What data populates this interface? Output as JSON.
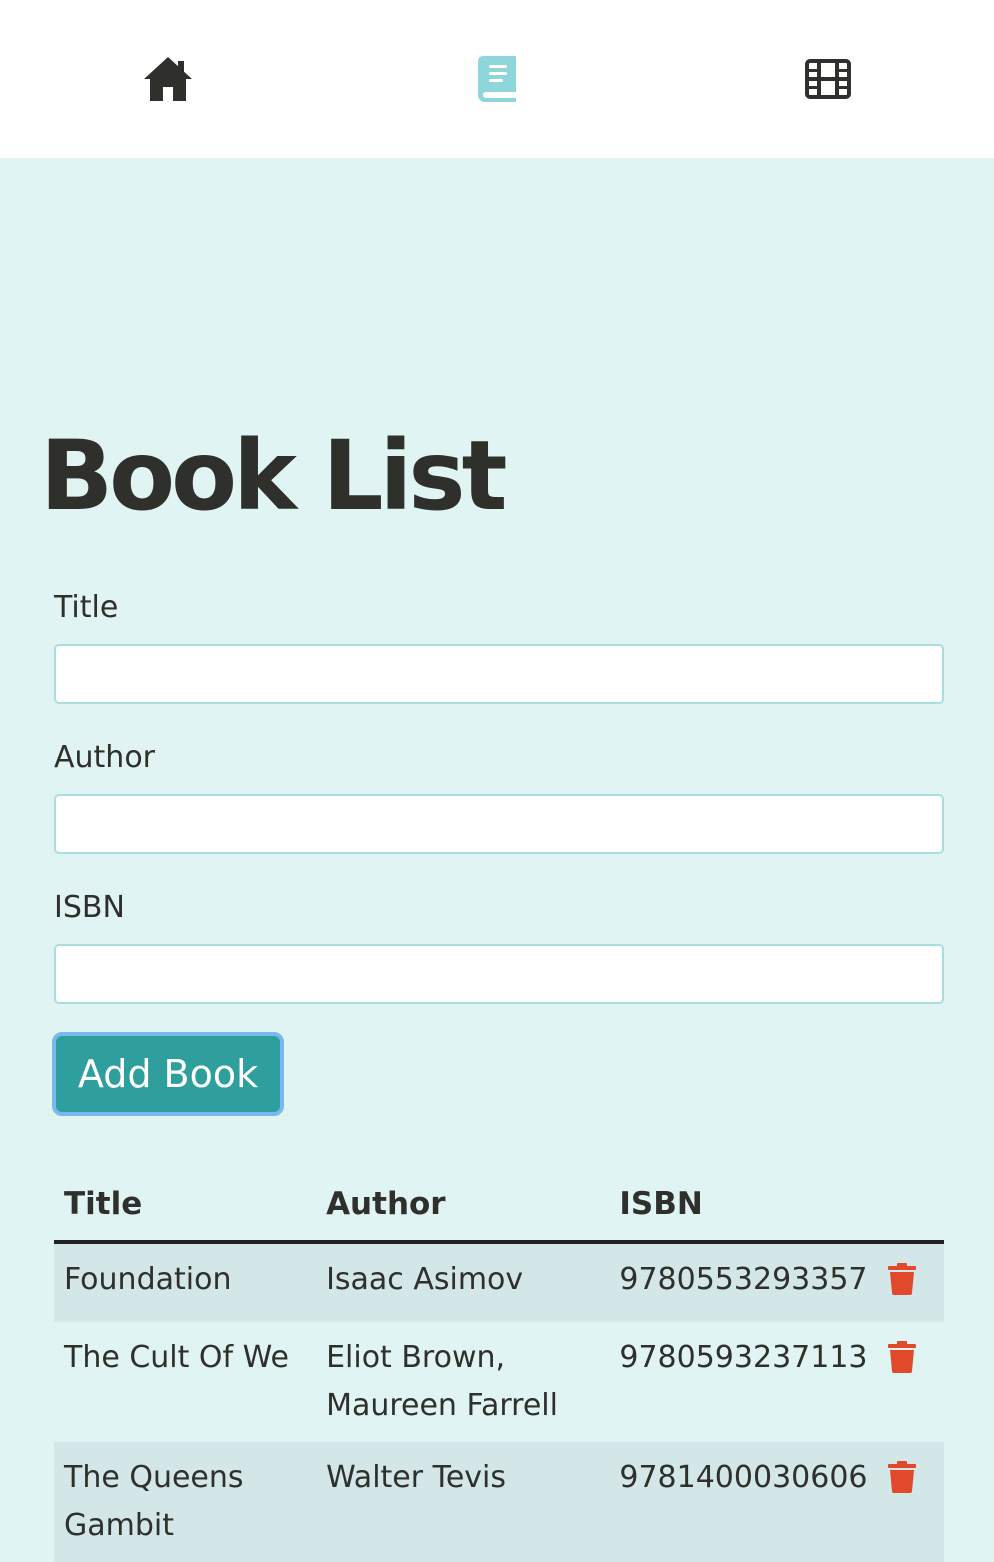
{
  "nav": {
    "items": [
      {
        "name": "home",
        "icon": "home-icon",
        "active": false
      },
      {
        "name": "books",
        "icon": "book-icon",
        "active": true
      },
      {
        "name": "movies",
        "icon": "film-icon",
        "active": false
      }
    ],
    "active_color": "#8fd6da",
    "inactive_color": "#2f302c"
  },
  "page": {
    "title": "Book List"
  },
  "form": {
    "title_label": "Title",
    "title_value": "",
    "author_label": "Author",
    "author_value": "",
    "isbn_label": "ISBN",
    "isbn_value": "",
    "submit_label": "Add Book"
  },
  "table": {
    "headers": [
      "Title",
      "Author",
      "ISBN"
    ],
    "rows": [
      {
        "title": "Foundation",
        "author": "Isaac Asimov",
        "isbn": "9780553293357"
      },
      {
        "title": "The Cult Of We",
        "author": "Eliot Brown, Maureen Farrell",
        "isbn": "9780593237113"
      },
      {
        "title": "The Queens Gambit",
        "author": "Walter Tevis",
        "isbn": "9781400030606"
      }
    ],
    "delete_icon": "trash-icon",
    "delete_color": "#e04a2b"
  },
  "colors": {
    "background": "#e0f4f4",
    "accent": "#2e9f9c",
    "button_border": "#7ab9ee",
    "input_border": "#a8dede"
  }
}
